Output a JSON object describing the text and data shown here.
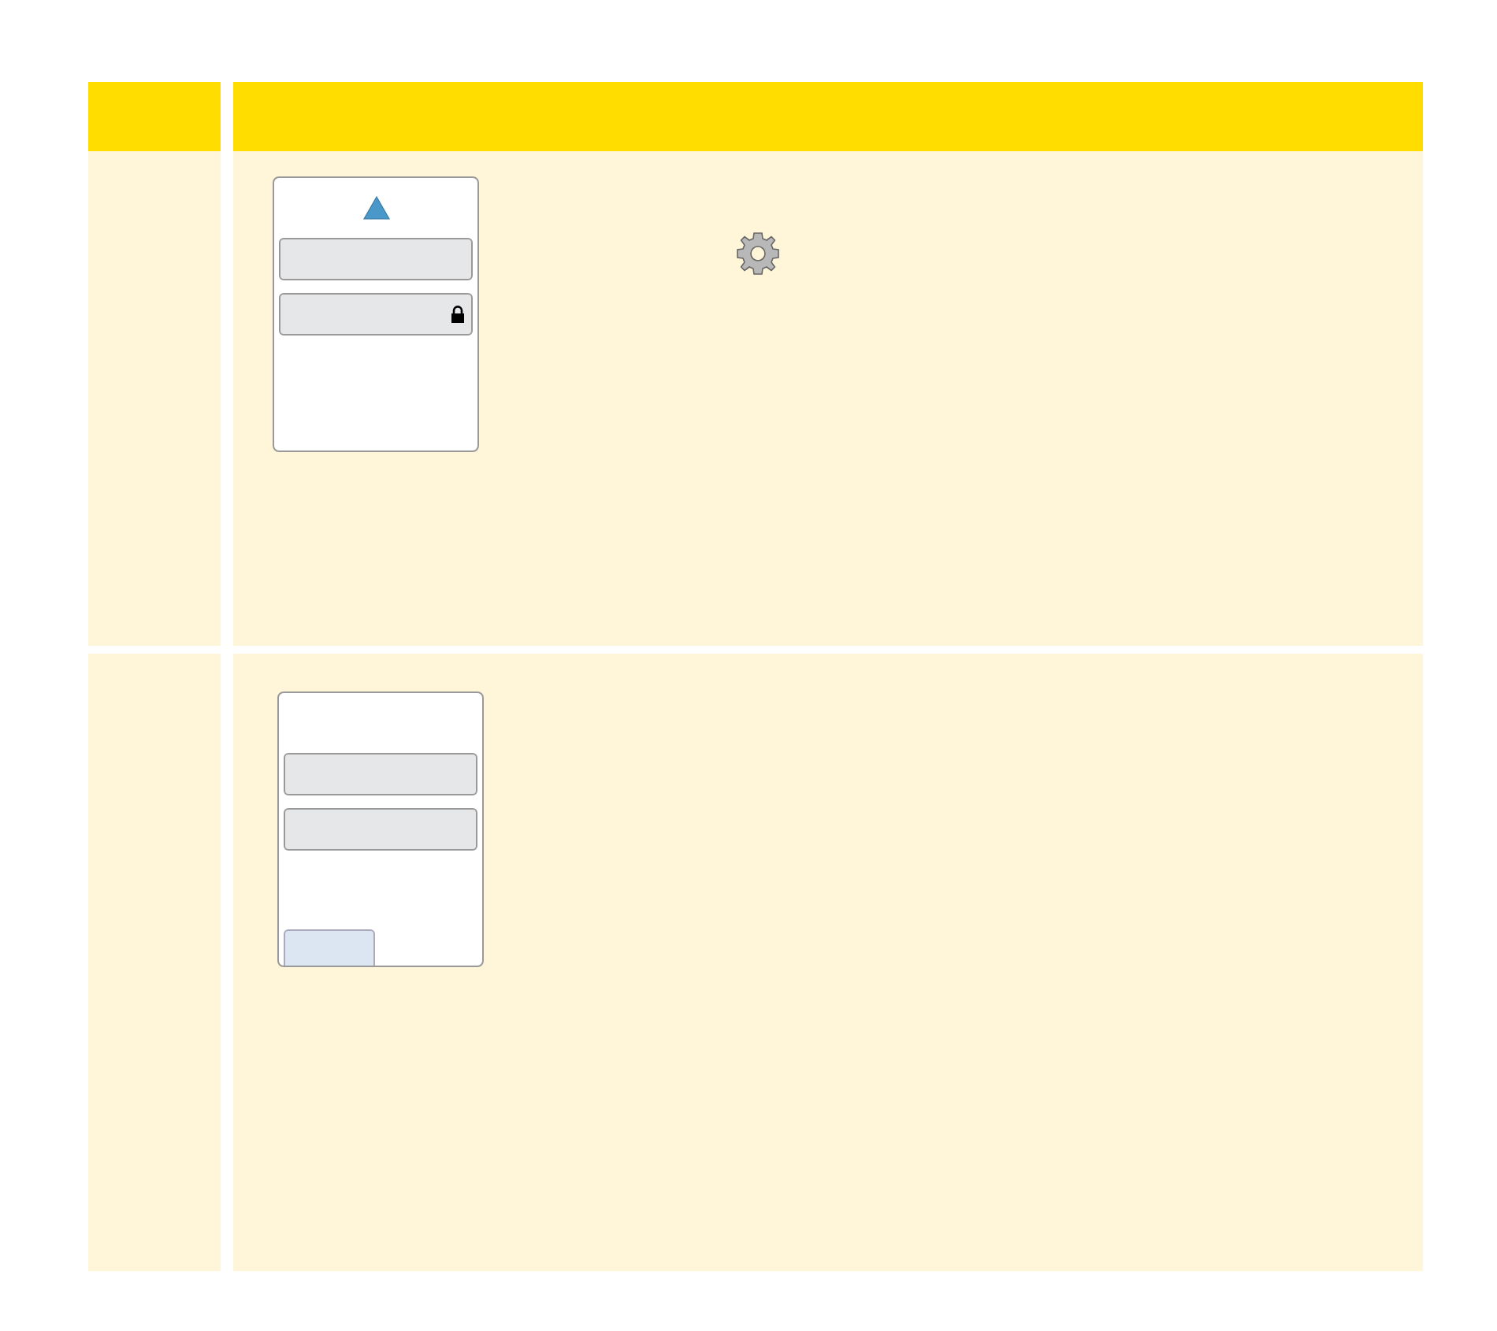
{
  "rows": [
    {
      "screen": {
        "up_arrow": true,
        "soft_key": false,
        "buttons": [
          {
            "locked": false
          },
          {
            "locked": true
          }
        ]
      },
      "gear_icon": true
    },
    {
      "screen": {
        "up_arrow": false,
        "soft_key": true,
        "buttons": [
          {
            "locked": false
          },
          {
            "locked": false
          }
        ]
      },
      "gear_icon": false
    }
  ]
}
